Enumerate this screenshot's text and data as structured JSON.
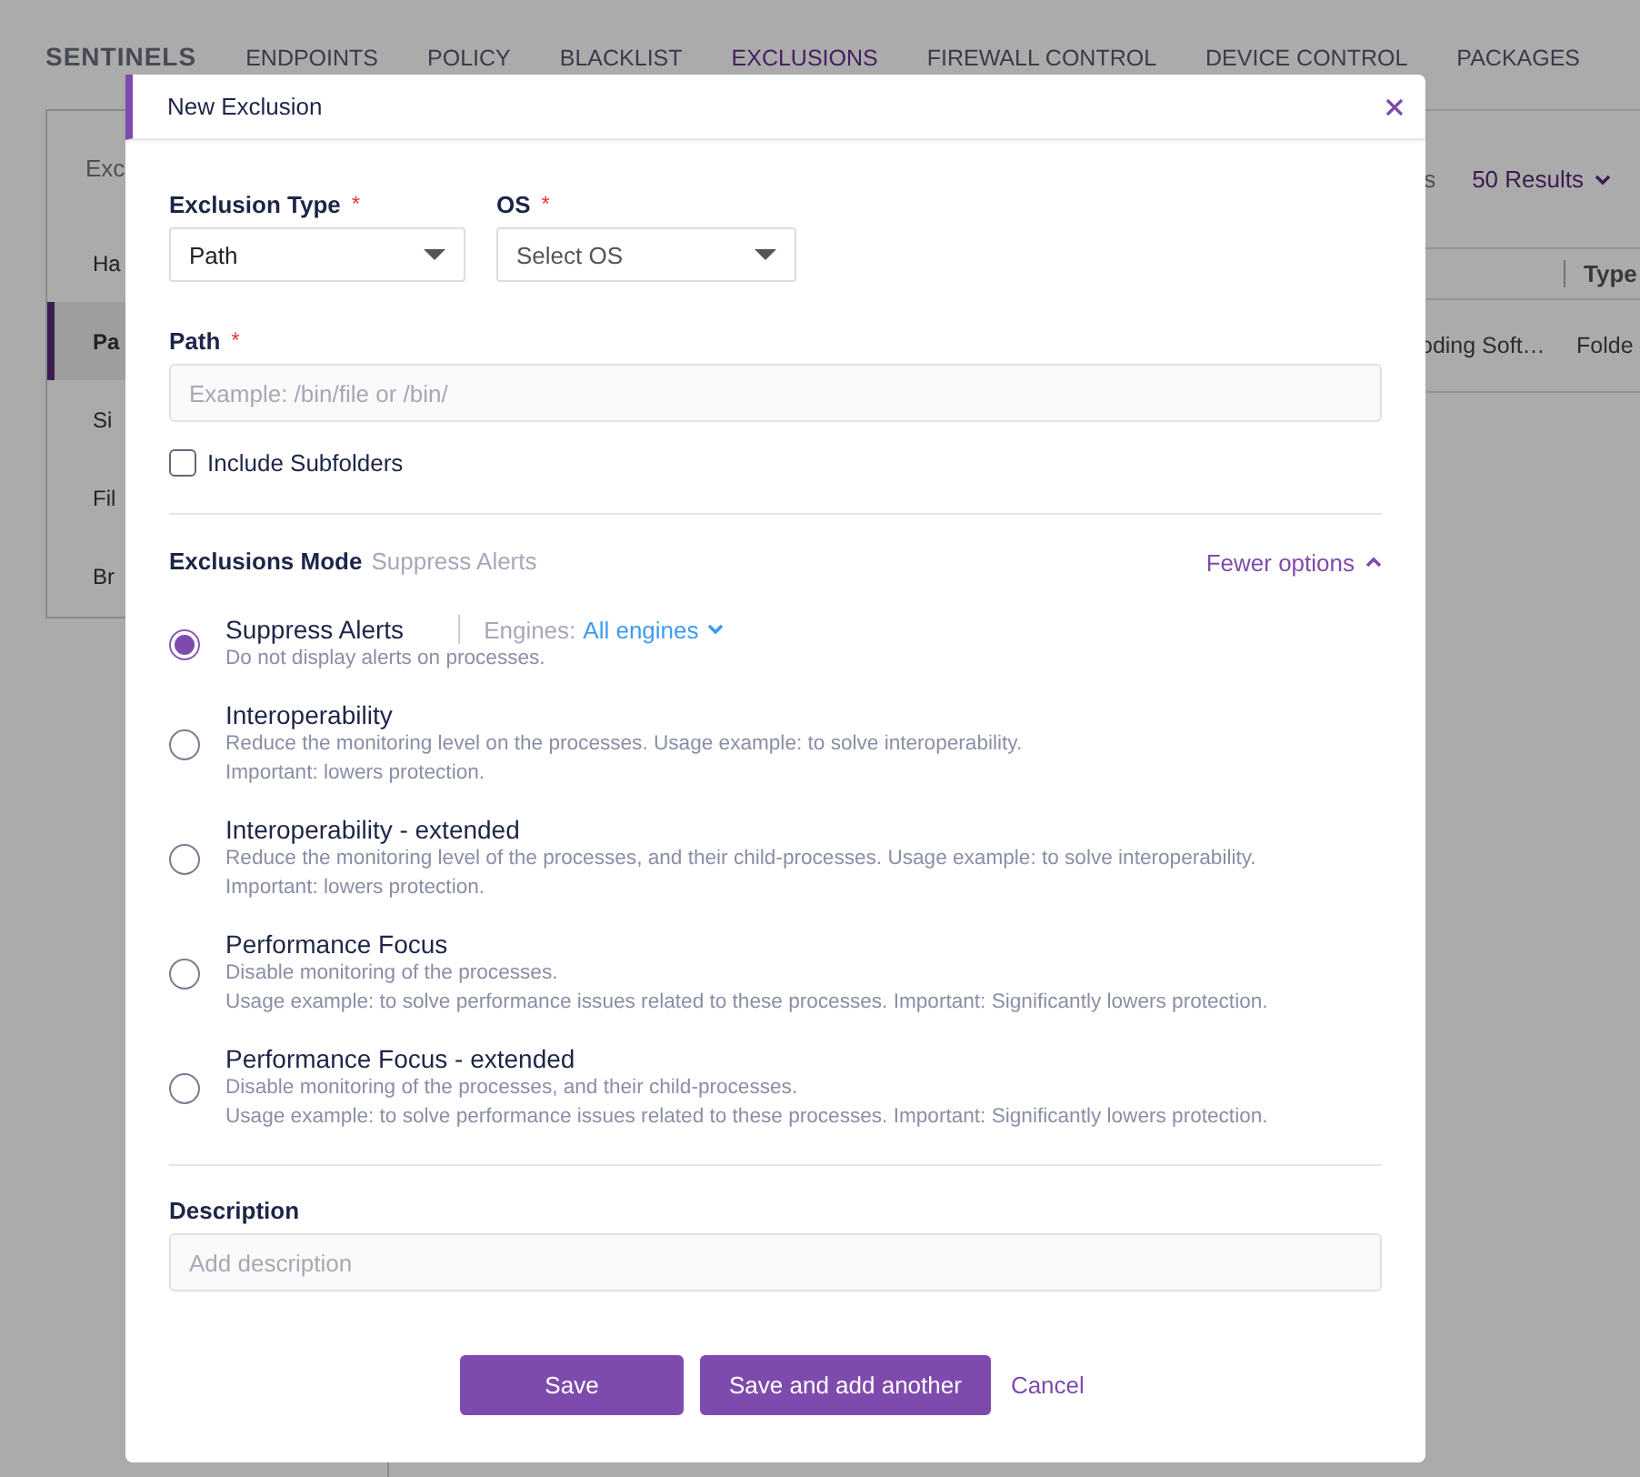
{
  "background": {
    "brand": "SENTINELS",
    "nav": [
      {
        "label": "ENDPOINTS",
        "selected": false
      },
      {
        "label": "POLICY",
        "selected": false
      },
      {
        "label": "BLACKLIST",
        "selected": false
      },
      {
        "label": "EXCLUSIONS",
        "selected": true
      },
      {
        "label": "FIREWALL CONTROL",
        "selected": false
      },
      {
        "label": "DEVICE CONTROL",
        "selected": false
      },
      {
        "label": "PACKAGES",
        "selected": false
      }
    ],
    "sidebar": {
      "title": "Exc",
      "items": [
        {
          "label": "Ha",
          "selected": false
        },
        {
          "label": "Pa",
          "selected": true
        },
        {
          "label": "Si",
          "selected": false
        },
        {
          "label": "Fil",
          "selected": false
        },
        {
          "label": "Br",
          "selected": false
        }
      ]
    },
    "results_partial": "s",
    "results": "50 Results",
    "table": {
      "columns": [
        "Type"
      ],
      "row": [
        "oding Soft…",
        "Folde"
      ]
    }
  },
  "dialog": {
    "title": "New Exclusion",
    "exclusion_type": {
      "label": "Exclusion Type",
      "required_mark": "*",
      "value": "Path"
    },
    "os": {
      "label": "OS",
      "required_mark": "*",
      "placeholder": "Select OS"
    },
    "path": {
      "label": "Path",
      "required_mark": "*",
      "placeholder": "Example: /bin/file or /bin/"
    },
    "include_subfolders": {
      "label": "Include Subfolders",
      "checked": false
    },
    "mode": {
      "label": "Exclusions Mode",
      "current": "Suppress Alerts",
      "toggle": "Fewer options",
      "expanded": true
    },
    "options": [
      {
        "title": "Suppress Alerts",
        "description": "Do not display alerts on processes.",
        "selected": true,
        "engines": {
          "label": "Engines:",
          "value": "All engines"
        }
      },
      {
        "title": "Interoperability",
        "description": "Reduce the monitoring level on the processes. Usage example: to solve interoperability.\nImportant: lowers protection.",
        "selected": false
      },
      {
        "title": "Interoperability - extended",
        "description": "Reduce the monitoring level of the processes, and their child-processes. Usage example: to solve interoperability.\nImportant: lowers protection.",
        "selected": false
      },
      {
        "title": "Performance Focus",
        "description": "Disable monitoring of the processes.\nUsage example: to solve performance issues related to these processes. Important: Significantly lowers protection.",
        "selected": false
      },
      {
        "title": "Performance Focus - extended",
        "description": "Disable monitoring of the processes, and their child-processes.\nUsage example: to solve performance issues related to these processes. Important: Significantly lowers protection.",
        "selected": false
      }
    ],
    "description": {
      "label": "Description",
      "placeholder": "Add description"
    },
    "buttons": [
      {
        "label": "Save",
        "kind": "primary"
      },
      {
        "label": "Save and add another",
        "kind": "primary"
      },
      {
        "label": "Cancel",
        "kind": "link"
      }
    ]
  }
}
